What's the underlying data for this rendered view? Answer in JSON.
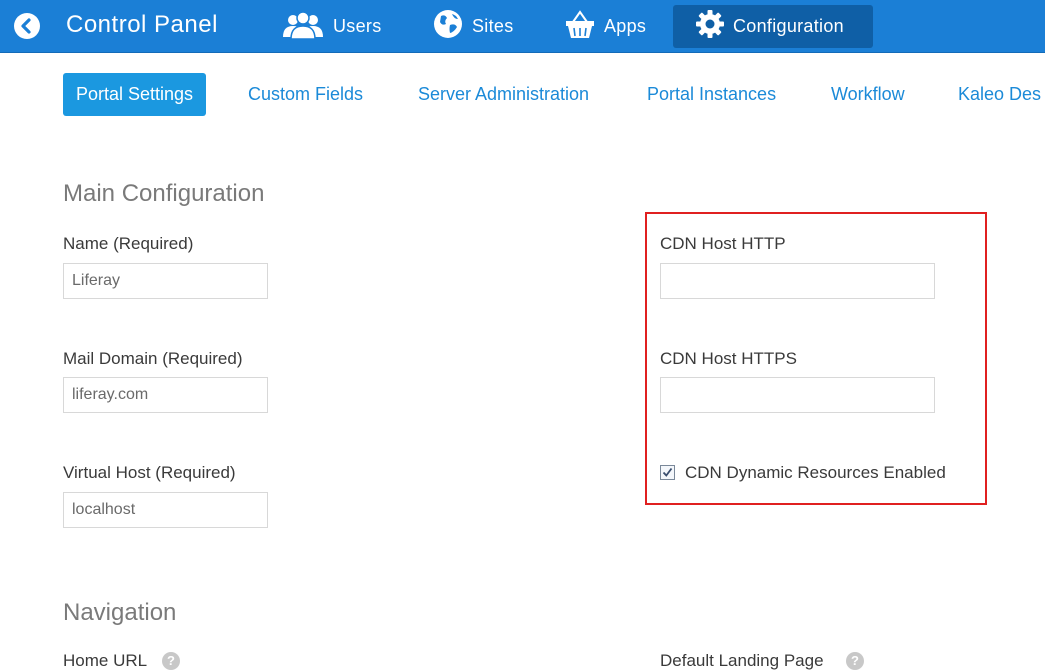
{
  "topbar": {
    "title": "Control Panel",
    "nav": [
      {
        "label": "Users",
        "icon": "users-icon"
      },
      {
        "label": "Sites",
        "icon": "globe-icon"
      },
      {
        "label": "Apps",
        "icon": "basket-icon"
      },
      {
        "label": "Configuration",
        "icon": "gear-icon",
        "active": true
      }
    ]
  },
  "subtabs": [
    {
      "label": "Portal Settings",
      "active": true
    },
    {
      "label": "Custom Fields"
    },
    {
      "label": "Server Administration"
    },
    {
      "label": "Portal Instances"
    },
    {
      "label": "Workflow"
    },
    {
      "label": "Kaleo Des"
    }
  ],
  "main_config": {
    "title": "Main Configuration",
    "name_label": "Name (Required)",
    "name_value": "Liferay",
    "mail_label": "Mail Domain (Required)",
    "mail_value": "liferay.com",
    "vhost_label": "Virtual Host (Required)",
    "vhost_value": "localhost"
  },
  "cdn": {
    "http_label": "CDN Host HTTP",
    "http_value": "",
    "https_label": "CDN Host HTTPS",
    "https_value": "",
    "dynamic_label": "CDN Dynamic Resources Enabled",
    "dynamic_checked": true
  },
  "navigation": {
    "title": "Navigation",
    "home_url_label": "Home URL",
    "default_landing_label": "Default Landing Page"
  },
  "colors": {
    "topbar": "#1b7fd6",
    "active_tab": "#1b98e0",
    "link": "#1b8ad8",
    "highlight_border": "#e02020"
  }
}
